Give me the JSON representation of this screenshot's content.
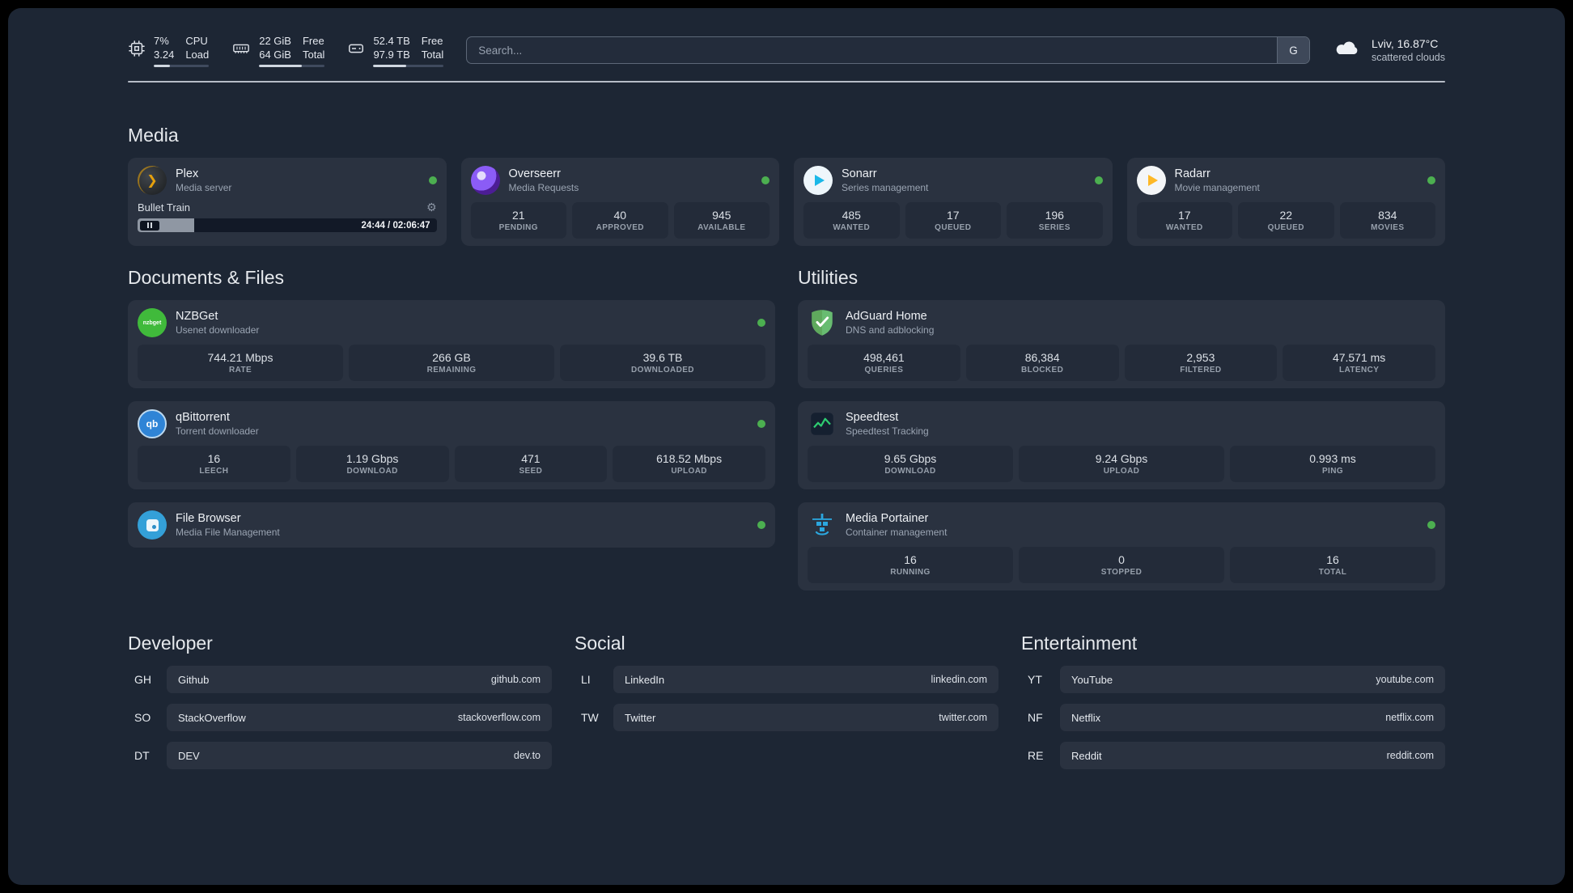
{
  "topbar": {
    "cpu": {
      "value1": "7%",
      "value2": "3.24",
      "label1": "CPU",
      "label2": "Load",
      "bar_percent": 30
    },
    "memory": {
      "value1": "22 GiB",
      "value2": "64 GiB",
      "label1": "Free",
      "label2": "Total",
      "bar_percent": 65
    },
    "disk": {
      "value1": "52.4 TB",
      "value2": "97.9 TB",
      "label1": "Free",
      "label2": "Total",
      "bar_percent": 47
    },
    "search": {
      "placeholder": "Search...",
      "button_label": "G"
    },
    "weather": {
      "location": "Lviv, 16.87°C",
      "condition": "scattered clouds"
    }
  },
  "media": {
    "title": "Media",
    "plex": {
      "name": "Plex",
      "subtitle": "Media server",
      "now_playing": "Bullet Train",
      "time": "24:44 / 02:06:47",
      "progress_percent": 19
    },
    "overseerr": {
      "name": "Overseerr",
      "subtitle": "Media Requests",
      "stats": [
        {
          "value": "21",
          "label": "PENDING"
        },
        {
          "value": "40",
          "label": "APPROVED"
        },
        {
          "value": "945",
          "label": "AVAILABLE"
        }
      ]
    },
    "sonarr": {
      "name": "Sonarr",
      "subtitle": "Series management",
      "stats": [
        {
          "value": "485",
          "label": "WANTED"
        },
        {
          "value": "17",
          "label": "QUEUED"
        },
        {
          "value": "196",
          "label": "SERIES"
        }
      ]
    },
    "radarr": {
      "name": "Radarr",
      "subtitle": "Movie management",
      "stats": [
        {
          "value": "17",
          "label": "WANTED"
        },
        {
          "value": "22",
          "label": "QUEUED"
        },
        {
          "value": "834",
          "label": "MOVIES"
        }
      ]
    }
  },
  "documents": {
    "title": "Documents & Files",
    "nzbget": {
      "name": "NZBGet",
      "subtitle": "Usenet downloader",
      "icon_text": "nzbget",
      "stats": [
        {
          "value": "744.21 Mbps",
          "label": "RATE"
        },
        {
          "value": "266 GB",
          "label": "REMAINING"
        },
        {
          "value": "39.6 TB",
          "label": "DOWNLOADED"
        }
      ]
    },
    "qbittorrent": {
      "name": "qBittorrent",
      "subtitle": "Torrent downloader",
      "icon_text": "qb",
      "stats": [
        {
          "value": "16",
          "label": "LEECH"
        },
        {
          "value": "1.19 Gbps",
          "label": "DOWNLOAD"
        },
        {
          "value": "471",
          "label": "SEED"
        },
        {
          "value": "618.52 Mbps",
          "label": "UPLOAD"
        }
      ]
    },
    "filebrowser": {
      "name": "File Browser",
      "subtitle": "Media File Management"
    }
  },
  "utilities": {
    "title": "Utilities",
    "adguard": {
      "name": "AdGuard Home",
      "subtitle": "DNS and adblocking",
      "stats": [
        {
          "value": "498,461",
          "label": "QUERIES"
        },
        {
          "value": "86,384",
          "label": "BLOCKED"
        },
        {
          "value": "2,953",
          "label": "FILTERED"
        },
        {
          "value": "47.571 ms",
          "label": "LATENCY"
        }
      ]
    },
    "speedtest": {
      "name": "Speedtest",
      "subtitle": "Speedtest Tracking",
      "stats": [
        {
          "value": "9.65 Gbps",
          "label": "DOWNLOAD"
        },
        {
          "value": "9.24 Gbps",
          "label": "UPLOAD"
        },
        {
          "value": "0.993 ms",
          "label": "PING"
        }
      ]
    },
    "portainer": {
      "name": "Media Portainer",
      "subtitle": "Container management",
      "stats": [
        {
          "value": "16",
          "label": "RUNNING"
        },
        {
          "value": "0",
          "label": "STOPPED"
        },
        {
          "value": "16",
          "label": "TOTAL"
        }
      ]
    }
  },
  "bookmarks": {
    "developer": {
      "title": "Developer",
      "items": [
        {
          "abbr": "GH",
          "name": "Github",
          "domain": "github.com"
        },
        {
          "abbr": "SO",
          "name": "StackOverflow",
          "domain": "stackoverflow.com"
        },
        {
          "abbr": "DT",
          "name": "DEV",
          "domain": "dev.to"
        }
      ]
    },
    "social": {
      "title": "Social",
      "items": [
        {
          "abbr": "LI",
          "name": "LinkedIn",
          "domain": "linkedin.com"
        },
        {
          "abbr": "TW",
          "name": "Twitter",
          "domain": "twitter.com"
        }
      ]
    },
    "entertainment": {
      "title": "Entertainment",
      "items": [
        {
          "abbr": "YT",
          "name": "YouTube",
          "domain": "youtube.com"
        },
        {
          "abbr": "NF",
          "name": "Netflix",
          "domain": "netflix.com"
        },
        {
          "abbr": "RE",
          "name": "Reddit",
          "domain": "reddit.com"
        }
      ]
    }
  },
  "colors": {
    "status_online": "#4caf50",
    "plex_accent": "#e5a00d"
  }
}
